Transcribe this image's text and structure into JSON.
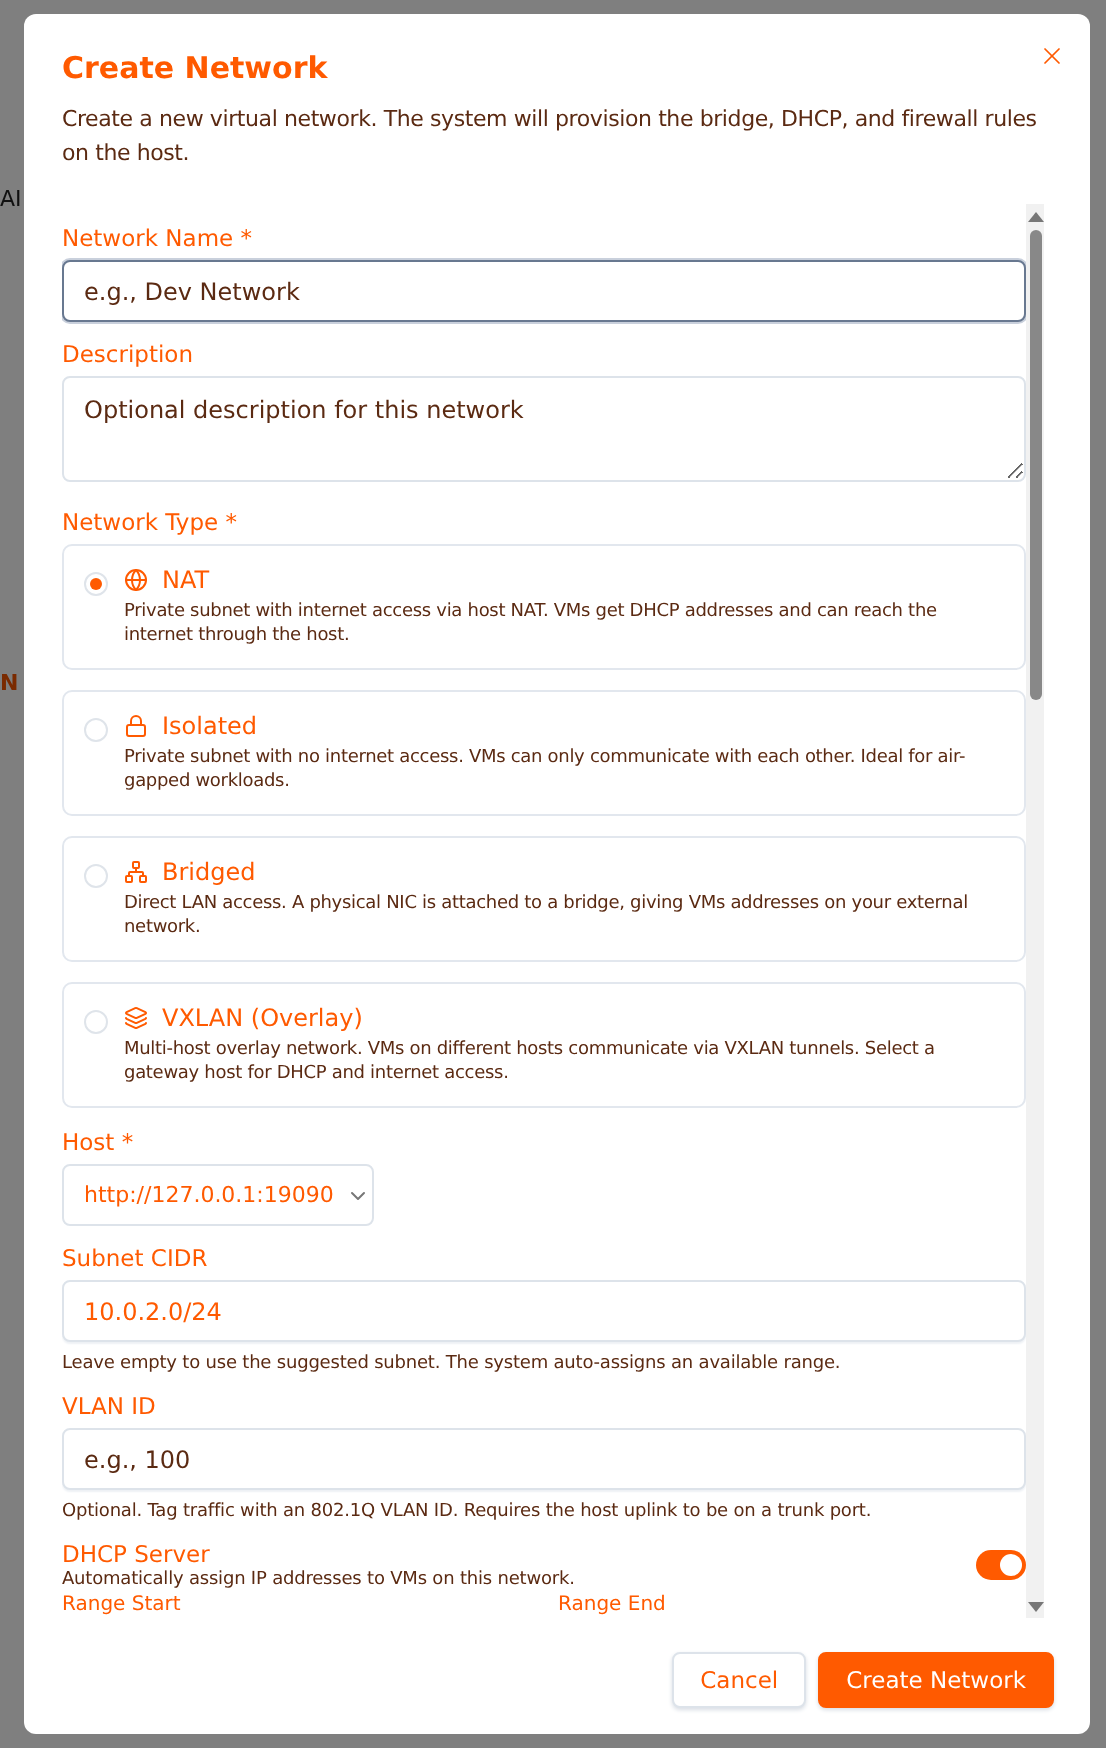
{
  "backdrop_texts": [
    "AI",
    "N"
  ],
  "dialog": {
    "title": "Create Network",
    "description": "Create a new virtual network. The system will provision the bridge, DHCP, and firewall rules on the host."
  },
  "name_field": {
    "label": "Network Name *",
    "placeholder": "e.g., Dev Network"
  },
  "description_field": {
    "label": "Description",
    "placeholder": "Optional description for this network"
  },
  "network_type": {
    "label": "Network Type *",
    "options": [
      {
        "kind": "globe",
        "title": "NAT",
        "text": "Private subnet with internet access via host NAT. VMs get DHCP addresses and can reach the internet through the host.",
        "selected": true
      },
      {
        "kind": "lock",
        "title": "Isolated",
        "text": "Private subnet with no internet access. VMs can only communicate with each other. Ideal for air-gapped workloads.",
        "selected": false
      },
      {
        "kind": "network",
        "title": "Bridged",
        "text": "Direct LAN access. A physical NIC is attached to a bridge, giving VMs addresses on your external network.",
        "selected": false
      },
      {
        "kind": "layers",
        "title": "VXLAN (Overlay)",
        "text": "Multi-host overlay network. VMs on different hosts communicate via VXLAN tunnels. Select a gateway host for DHCP and internet access.",
        "selected": false
      }
    ]
  },
  "host": {
    "label": "Host *",
    "value": "http://127.0.0.1:19090"
  },
  "subnet": {
    "label": "Subnet CIDR",
    "value": "10.0.2.0/24",
    "hint": "Leave empty to use the suggested subnet. The system auto-assigns an available range."
  },
  "vlan": {
    "label": "VLAN ID",
    "placeholder": "e.g., 100",
    "hint": "Optional. Tag traffic with an 802.1Q VLAN ID. Requires the host uplink to be on a trunk port."
  },
  "dhcp": {
    "label": "DHCP Server",
    "text": "Automatically assign IP addresses to VMs on this network.",
    "on": true
  },
  "range_labels": [
    "Range Start",
    "Range End"
  ],
  "buttons": {
    "cancel": "Cancel",
    "submit": "Create Network"
  }
}
